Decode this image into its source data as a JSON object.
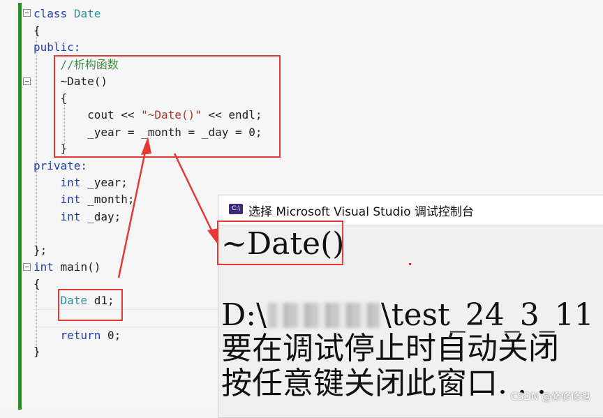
{
  "code": {
    "class_kw": "class",
    "class_name": "Date",
    "open_brace": "{",
    "public": "public:",
    "comment": "//析构函数",
    "dtor": "~Date()",
    "dtor_open": "{",
    "cout_line_a": "cout << ",
    "cout_str": "\"~Date()\"",
    "cout_line_b": " << endl;",
    "assign_line": "_year = _month = _day = 0;",
    "dtor_close": "}",
    "private": "private:",
    "int_kw": "int",
    "member_year": " _year;",
    "member_month": " _month;",
    "member_day": " _day;",
    "class_close": "};",
    "main_kw": "int",
    "main_rest": " main()",
    "main_open": "{",
    "date_type": "Date",
    "date_decl": " d1;",
    "return_kw": "return",
    "return_rest": " 0;",
    "main_close": "}"
  },
  "console": {
    "title": "选择 Microsoft Visual Studio 调试控制台",
    "icon_label": "C:\\",
    "output_line": "~Date()",
    "path_prefix": "D:\\",
    "path_suffix": "\\test_24_3_11",
    "msg1": "要在调试停止时自动关闭",
    "msg2": "按任意键关闭此窗口. . ."
  },
  "watermark": "CSDN @修修修也",
  "colors": {
    "keyword": "#1f3fb0",
    "type": "#2b8fa3",
    "comment": "#3f8f3f",
    "string": "#a33a2d",
    "highlight_box": "#e53935",
    "change_bar": "#2e8b2e"
  }
}
